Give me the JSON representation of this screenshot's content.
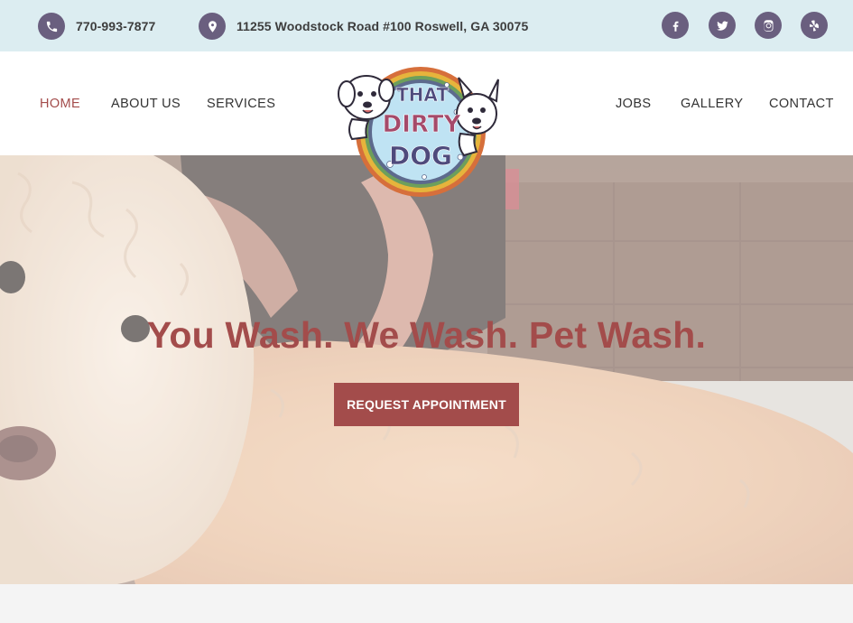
{
  "topbar": {
    "phone": "770-993-7877",
    "address": "11255 Woodstock Road #100 Roswell, GA 30075",
    "social": [
      "facebook-icon",
      "twitter-icon",
      "instagram-icon",
      "yelp-icon"
    ]
  },
  "nav": {
    "home": "HOME",
    "about": "ABOUT US",
    "services": "SERVICES",
    "jobs": "JOBS",
    "gallery": "GALLERY",
    "contact": "CONTACT"
  },
  "logo": {
    "line1": "THAT",
    "line2": "DIRTY",
    "line3": "DOG"
  },
  "hero": {
    "title": "You Wash. We Wash. Pet Wash.",
    "cta": "REQUEST APPOINTMENT"
  },
  "colors": {
    "topbar_bg": "#dcedf1",
    "icon_circle": "#6a5f7f",
    "accent": "#a34c4b",
    "nav_text": "#333333"
  }
}
